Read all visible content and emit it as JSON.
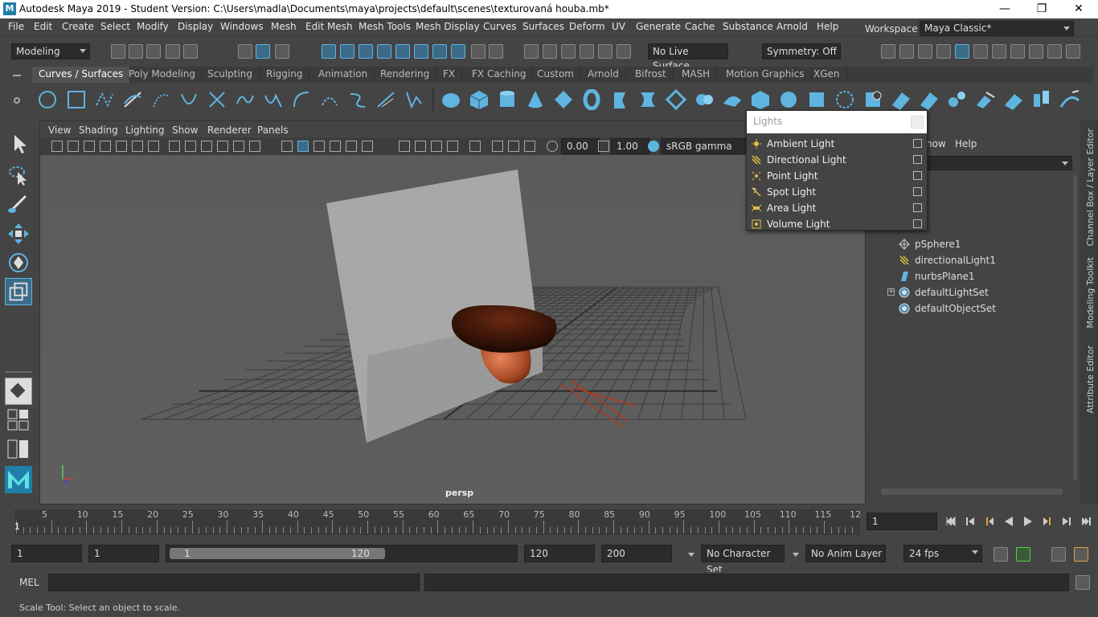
{
  "window": {
    "title": "Autodesk Maya 2019 - Student Version: C:\\Users\\madla\\Documents\\maya\\projects\\default\\scenes\\texturovaná houba.mb*",
    "logo": "M",
    "controls": [
      "—",
      "❐",
      "✕"
    ]
  },
  "menubar": {
    "items": [
      "File",
      "Edit",
      "Create",
      "Select",
      "Modify",
      "Display",
      "Windows",
      "Mesh",
      "Edit Mesh",
      "Mesh Tools",
      "Mesh Display",
      "Curves",
      "Surfaces",
      "Deform",
      "UV",
      "Generate",
      "Cache",
      "Substance",
      "Arnold",
      "Help"
    ],
    "workspace_label": "Workspace :",
    "workspace_value": "Maya Classic*"
  },
  "statusline": {
    "menuset": "Modeling",
    "live_surface": "No Live Surface",
    "symmetry": "Symmetry: Off"
  },
  "shelf": {
    "tabs": [
      "Curves / Surfaces",
      "Poly Modeling",
      "Sculpting",
      "Rigging",
      "Animation",
      "Rendering",
      "FX",
      "FX Caching",
      "Custom",
      "Arnold",
      "Bifrost",
      "MASH",
      "Motion Graphics",
      "XGen"
    ],
    "active_tab": "Curves / Surfaces"
  },
  "viewport": {
    "menu": [
      "View",
      "Shading",
      "Lighting",
      "Show",
      "Renderer",
      "Panels"
    ],
    "exposure": "0.00",
    "gamma": "1.00",
    "color_space": "sRGB gamma",
    "camera_label": "persp"
  },
  "outliner": {
    "menu": [
      "how",
      "Help"
    ],
    "items": [
      "pSphere1",
      "directionalLight1",
      "nurbsPlane1",
      "defaultLightSet",
      "defaultObjectSet"
    ]
  },
  "side_tabs": [
    "Channel Box / Layer Editor",
    "Modeling Toolkit",
    "Attribute Editor"
  ],
  "lights_popup": {
    "title": "Lights",
    "items": [
      "Ambient Light",
      "Directional Light",
      "Point Light",
      "Spot Light",
      "Area Light",
      "Volume Light"
    ]
  },
  "timeline": {
    "ticks": [
      "5",
      "10",
      "15",
      "20",
      "25",
      "30",
      "35",
      "40",
      "45",
      "50",
      "55",
      "60",
      "65",
      "70",
      "75",
      "80",
      "85",
      "90",
      "95",
      "100",
      "105",
      "110",
      "115",
      "12"
    ],
    "start_mark": "1",
    "current_frame": "1"
  },
  "range": {
    "start": "1",
    "playback_start": "1",
    "slider_start": "1",
    "slider_end": "120",
    "playback_end": "120",
    "end": "200",
    "character_set": "No Character Set",
    "anim_layer": "No Anim Layer",
    "fps": "24 fps"
  },
  "command": {
    "label": "MEL"
  },
  "help_line": "Scale Tool: Select an object to scale.",
  "colors": {
    "accent": "#5fb4e0",
    "panel": "#444444",
    "viewport_bg": "#5c5c5c"
  }
}
